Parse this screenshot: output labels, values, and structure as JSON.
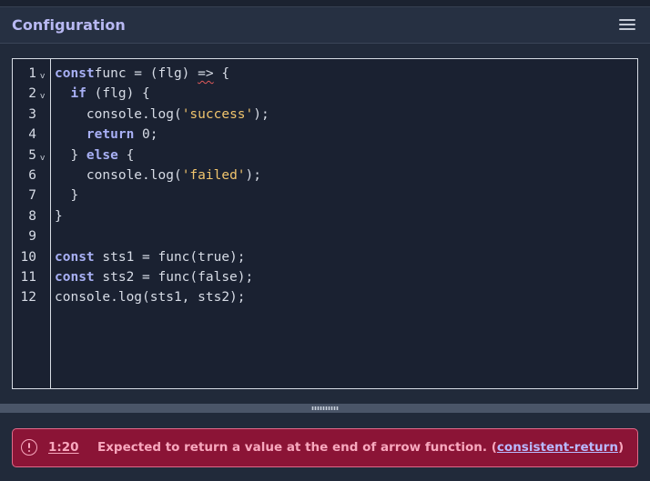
{
  "header": {
    "title": "Configuration",
    "menu_icon": "hamburger-menu-icon"
  },
  "editor": {
    "lines": [
      {
        "num": "1",
        "fold": true,
        "tokens": [
          [
            "kw",
            "const"
          ],
          [
            "",
            "func = (flg) "
          ],
          [
            "sq",
            "=>"
          ],
          [
            "",
            " {"
          ]
        ]
      },
      {
        "num": "2",
        "fold": true,
        "tokens": [
          [
            "",
            "  "
          ],
          [
            "kw",
            "if"
          ],
          [
            "",
            " (flg) {"
          ]
        ]
      },
      {
        "num": "3",
        "fold": false,
        "tokens": [
          [
            "",
            "    console.log("
          ],
          [
            "str",
            "'success'"
          ],
          [
            "",
            ");"
          ]
        ]
      },
      {
        "num": "4",
        "fold": false,
        "tokens": [
          [
            "",
            "    "
          ],
          [
            "kw",
            "return"
          ],
          [
            "",
            " 0;"
          ]
        ]
      },
      {
        "num": "5",
        "fold": true,
        "tokens": [
          [
            "",
            "  } "
          ],
          [
            "kw",
            "else"
          ],
          [
            "",
            " {"
          ]
        ]
      },
      {
        "num": "6",
        "fold": false,
        "tokens": [
          [
            "",
            "    console.log("
          ],
          [
            "str",
            "'failed'"
          ],
          [
            "",
            ");"
          ]
        ]
      },
      {
        "num": "7",
        "fold": false,
        "tokens": [
          [
            "",
            "  }"
          ]
        ]
      },
      {
        "num": "8",
        "fold": false,
        "tokens": [
          [
            "",
            "}"
          ]
        ]
      },
      {
        "num": "9",
        "fold": false,
        "tokens": []
      },
      {
        "num": "10",
        "fold": false,
        "tokens": [
          [
            "kw",
            "const"
          ],
          [
            "",
            " sts1 = func(true);"
          ]
        ]
      },
      {
        "num": "11",
        "fold": false,
        "tokens": [
          [
            "kw",
            "const"
          ],
          [
            "",
            " sts2 = func(false);"
          ]
        ]
      },
      {
        "num": "12",
        "fold": false,
        "tokens": [
          [
            "",
            "console.log(sts1, sts2);"
          ]
        ]
      }
    ],
    "fold_marker": "v"
  },
  "error": {
    "icon": "alert-circle-icon",
    "location": "1:20",
    "message": "Expected to return a value at the end of arrow function. (",
    "rule": "consistent-return",
    "message_end": ")"
  },
  "colors": {
    "background": "#212a3a",
    "title": "#b8b8f2",
    "keyword": "#a8b0f5",
    "string": "#f0c46d",
    "error_bg": "#8b1436"
  }
}
